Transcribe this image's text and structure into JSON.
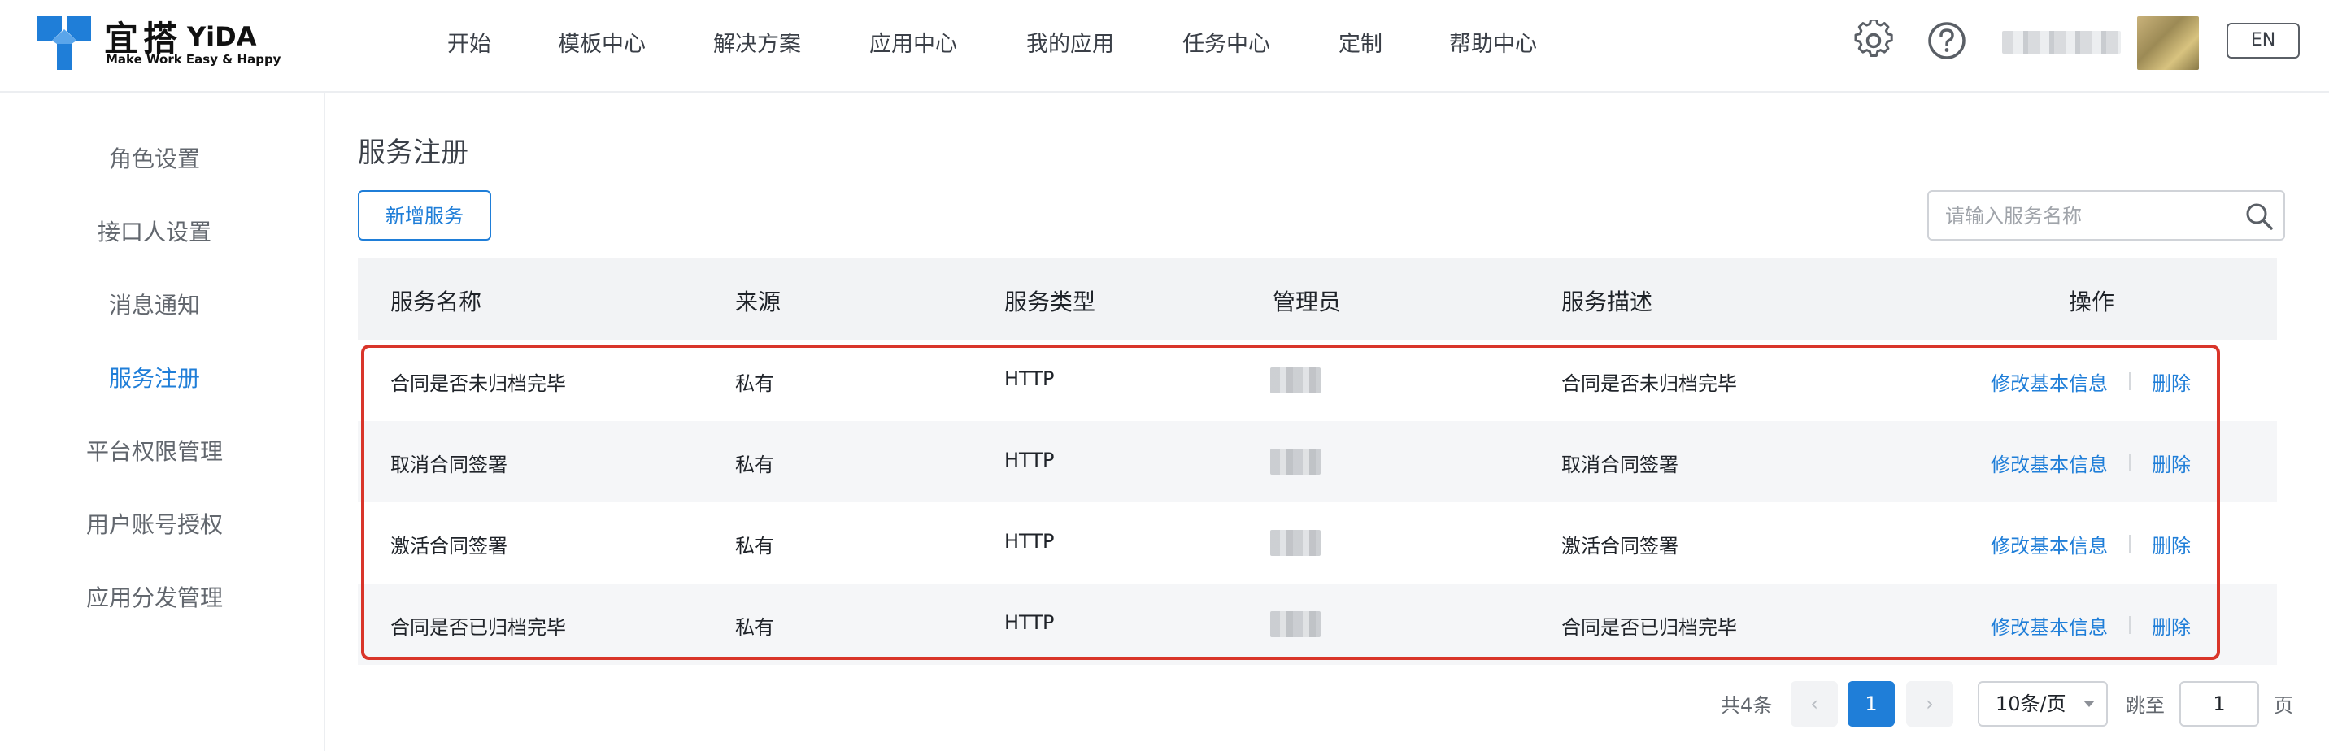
{
  "brand": {
    "cn": "宜搭",
    "en": "YiDA",
    "tagline": "Make Work Easy & Happy",
    "color": "#1f7ed8"
  },
  "nav": [
    "开始",
    "模板中心",
    "解决方案",
    "应用中心",
    "我的应用",
    "任务中心",
    "定制",
    "帮助中心"
  ],
  "header": {
    "settings_icon": "gear-icon",
    "help_icon": "help-circle-icon",
    "lang": "EN"
  },
  "sidebar": {
    "items": [
      {
        "label": "角色设置"
      },
      {
        "label": "接口人设置"
      },
      {
        "label": "消息通知"
      },
      {
        "label": "服务注册",
        "active": true
      },
      {
        "label": "平台权限管理"
      },
      {
        "label": "用户账号授权"
      },
      {
        "label": "应用分发管理"
      }
    ]
  },
  "main": {
    "title": "服务注册",
    "add_button": "新增服务",
    "search_placeholder": "请输入服务名称"
  },
  "table": {
    "columns": [
      "服务名称",
      "来源",
      "服务类型",
      "管理员",
      "服务描述",
      "操作"
    ],
    "rows": [
      {
        "name": "合同是否未归档完毕",
        "source": "私有",
        "type": "HTTP",
        "desc": "合同是否未归档完毕"
      },
      {
        "name": "取消合同签署",
        "source": "私有",
        "type": "HTTP",
        "desc": "取消合同签署"
      },
      {
        "name": "激活合同签署",
        "source": "私有",
        "type": "HTTP",
        "desc": "激活合同签署"
      },
      {
        "name": "合同是否已归档完毕",
        "source": "私有",
        "type": "HTTP",
        "desc": "合同是否已归档完毕"
      }
    ],
    "actions": {
      "edit": "修改基本信息",
      "delete": "删除"
    }
  },
  "pagination": {
    "total": "共4条",
    "prev": "‹",
    "current": "1",
    "next": "›",
    "page_size": "10条/页",
    "jump_label": "跳至",
    "jump_value": "1",
    "page_suffix": "页"
  },
  "highlight_color": "#d9352a"
}
